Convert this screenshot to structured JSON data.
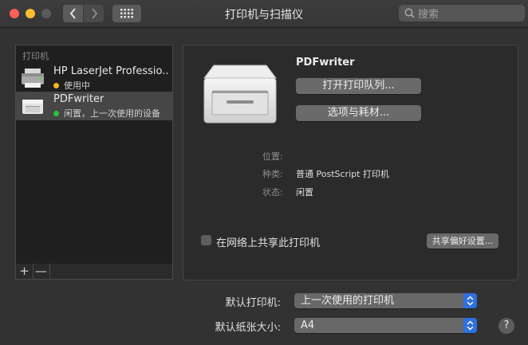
{
  "window": {
    "title": "打印机与扫描仪",
    "search_placeholder": "搜索"
  },
  "printer_list": {
    "header": "打印机",
    "items": [
      {
        "name": "HP LaserJet Professio...",
        "status": "使用中",
        "status_color": "#f5b526",
        "selected": false
      },
      {
        "name": "PDFwriter",
        "status": "闲置，上一次使用的设备",
        "status_color": "#29c33f",
        "selected": true
      }
    ],
    "add_label": "+",
    "remove_label": "—"
  },
  "detail": {
    "name": "PDFwriter",
    "open_queue_button": "打开打印队列...",
    "options_button": "选项与耗材...",
    "info": [
      {
        "label": "位置:",
        "value": ""
      },
      {
        "label": "种类:",
        "value": "普通 PostScript 打印机"
      },
      {
        "label": "状态:",
        "value": "闲置"
      }
    ],
    "share_checkbox_label": "在网络上共享此打印机",
    "share_checked": false,
    "share_prefs_button": "共享偏好设置..."
  },
  "defaults": {
    "default_printer_label": "默认打印机:",
    "default_printer_value": "上一次使用的打印机",
    "default_paper_label": "默认纸张大小:",
    "default_paper_value": "A4"
  },
  "help_label": "?",
  "colors": {
    "accent": "#2f6fde",
    "close": "#fe5f57",
    "minimize": "#febc2e",
    "selected_row": "#464646"
  }
}
